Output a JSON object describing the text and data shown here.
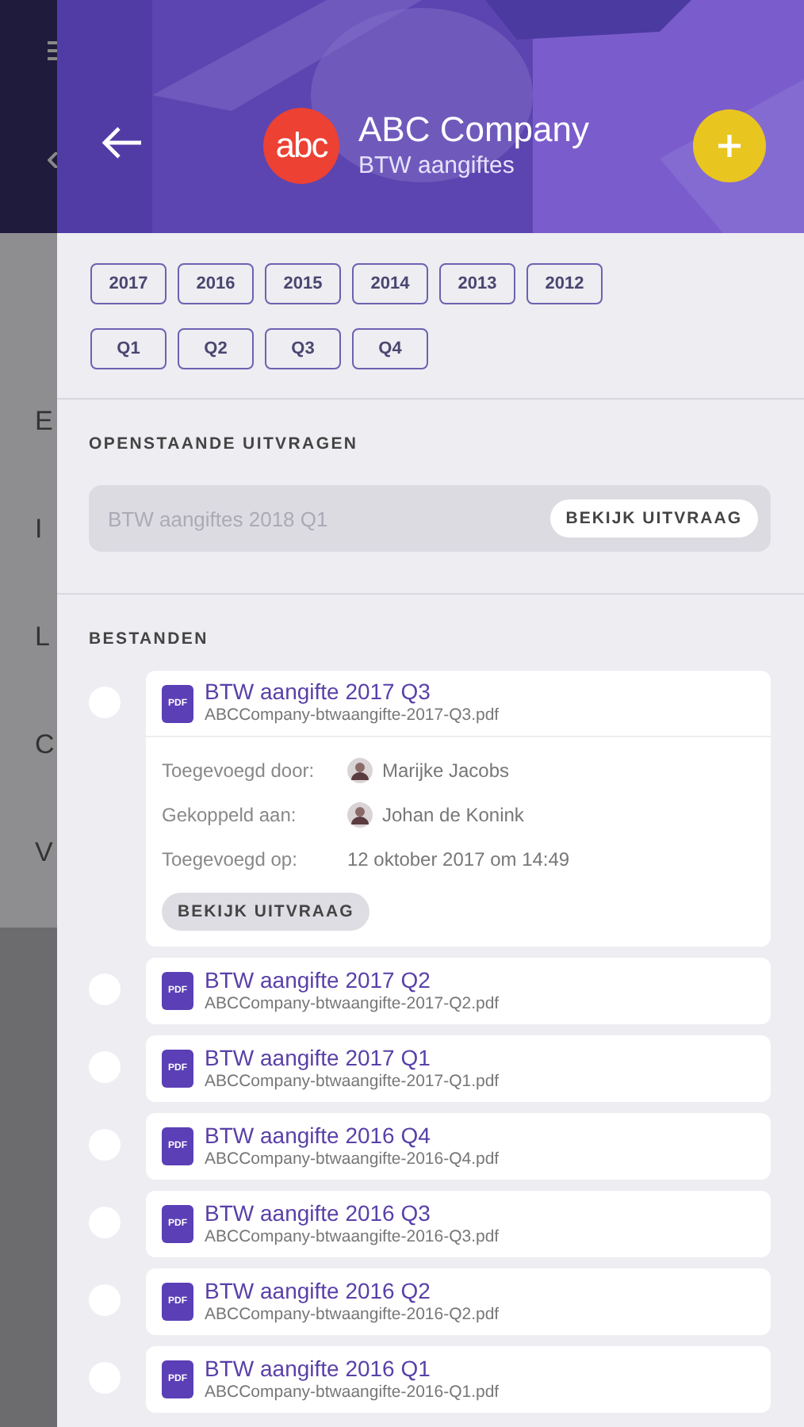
{
  "background_menu": {
    "items": [
      "E",
      "I",
      "L",
      "C",
      "V"
    ]
  },
  "header": {
    "title": "ABC Company",
    "subtitle": "BTW aangiftes",
    "logo_text": "abc"
  },
  "year_filters": [
    {
      "label": "2017",
      "selected": false
    },
    {
      "label": "2016",
      "selected": false
    },
    {
      "label": "2015",
      "selected": false
    },
    {
      "label": "2014",
      "selected": false
    },
    {
      "label": "2013",
      "selected": false
    },
    {
      "label": "2012",
      "selected": false
    }
  ],
  "quarter_filters": [
    {
      "label": "Q1",
      "selected": false
    },
    {
      "label": "Q2",
      "selected": false
    },
    {
      "label": "Q3",
      "selected": false
    },
    {
      "label": "Q4",
      "selected": false
    }
  ],
  "open_requests": {
    "heading": "OPENSTAANDE UITVRAGEN",
    "items": [
      {
        "title": "BTW aangiftes 2018 Q1",
        "button": "BEKIJK UITVRAAG"
      }
    ]
  },
  "files": {
    "heading": "BESTANDEN",
    "items": [
      {
        "title": "BTW aangifte 2017 Q3",
        "filename": "ABCCompany-btwaangifte-2017-Q3.pdf",
        "badge": "PDF",
        "selected": false,
        "expanded": true,
        "details": [
          {
            "kind": "person",
            "label": "Toegevoegd door:",
            "value": "Marijke Jacobs"
          },
          {
            "kind": "person",
            "label": "Gekoppeld aan:",
            "value": "Johan de Konink"
          },
          {
            "kind": "text",
            "label": "Toegevoegd op:",
            "value": "12 oktober 2017 om 14:49"
          }
        ],
        "button": "BEKIJK UITVRAAG"
      },
      {
        "title": "BTW aangifte 2017 Q2",
        "filename": "ABCCompany-btwaangifte-2017-Q2.pdf",
        "badge": "PDF",
        "selected": false,
        "expanded": false
      },
      {
        "title": "BTW aangifte 2017 Q1",
        "filename": "ABCCompany-btwaangifte-2017-Q1.pdf",
        "badge": "PDF",
        "selected": false,
        "expanded": false
      },
      {
        "title": "BTW aangifte 2016 Q4",
        "filename": "ABCCompany-btwaangifte-2016-Q4.pdf",
        "badge": "PDF",
        "selected": false,
        "expanded": false
      },
      {
        "title": "BTW aangifte 2016 Q3",
        "filename": "ABCCompany-btwaangifte-2016-Q3.pdf",
        "badge": "PDF",
        "selected": false,
        "expanded": false
      },
      {
        "title": "BTW aangifte 2016 Q2",
        "filename": "ABCCompany-btwaangifte-2016-Q2.pdf",
        "badge": "PDF",
        "selected": false,
        "expanded": false
      },
      {
        "title": "BTW aangifte 2016 Q1",
        "filename": "ABCCompany-btwaangifte-2016-Q1.pdf",
        "badge": "PDF",
        "selected": false,
        "expanded": false
      }
    ]
  }
}
